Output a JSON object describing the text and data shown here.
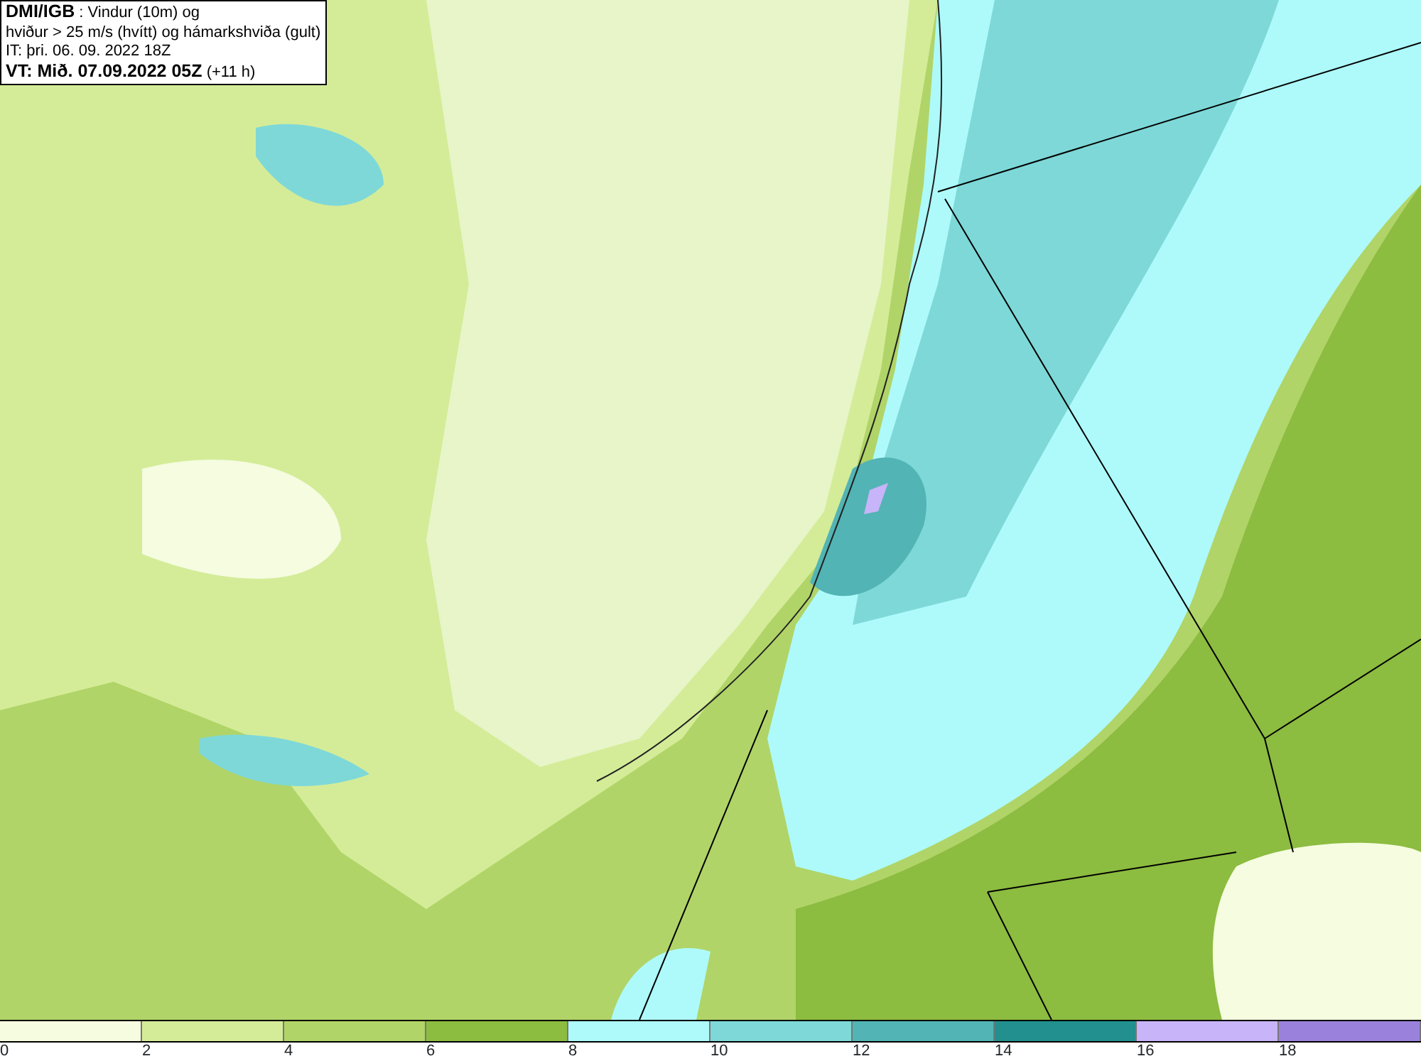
{
  "title_box": {
    "lines": [
      "**DMI/IGB** : Vindur (10m) og",
      "hviður > 25 m/s (hvítt) og hámarkshviða (gult)",
      "IT: þri. 06. 09. 2022 18Z",
      "**VT: Mið. 07.09.2022 05Z** (+11 h)"
    ]
  },
  "legend": {
    "bins": [
      {
        "color": "#f5fce0"
      },
      {
        "color": "#d4ec98"
      },
      {
        "color": "#b0d468"
      },
      {
        "color": "#8cbc40"
      },
      {
        "color": "#aefafa"
      },
      {
        "color": "#7ed8d8"
      },
      {
        "color": "#52b4b4"
      },
      {
        "color": "#22908e"
      },
      {
        "color": "#c8b4f8"
      },
      {
        "color": "#9a82dc"
      }
    ],
    "ticks": [
      "0",
      "2",
      "4",
      "6",
      "8",
      "10",
      "12",
      "14",
      "16",
      "18"
    ]
  }
}
